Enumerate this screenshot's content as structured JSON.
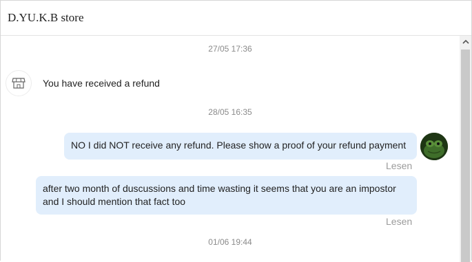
{
  "header": {
    "title": "D.YU.K.B store"
  },
  "messages": [
    {
      "timestamp": "27/05 17:36"
    },
    {
      "system_text": "You have received a refund"
    },
    {
      "timestamp": "28/05 16:35"
    },
    {
      "text": "NO I did NOT receive any refund. Please show a proof of your refund payment",
      "status": "Lesen"
    },
    {
      "text_line1": "after two month of duscussions and time wasting it seems that you are an impostor",
      "text_line2": "and I should mention that fact too",
      "status": "Lesen"
    },
    {
      "timestamp": "01/06 19:44"
    }
  ],
  "icons": {
    "shop": "store-icon",
    "avatar": "user-avatar",
    "scroll_up": "chevron-up-icon"
  }
}
